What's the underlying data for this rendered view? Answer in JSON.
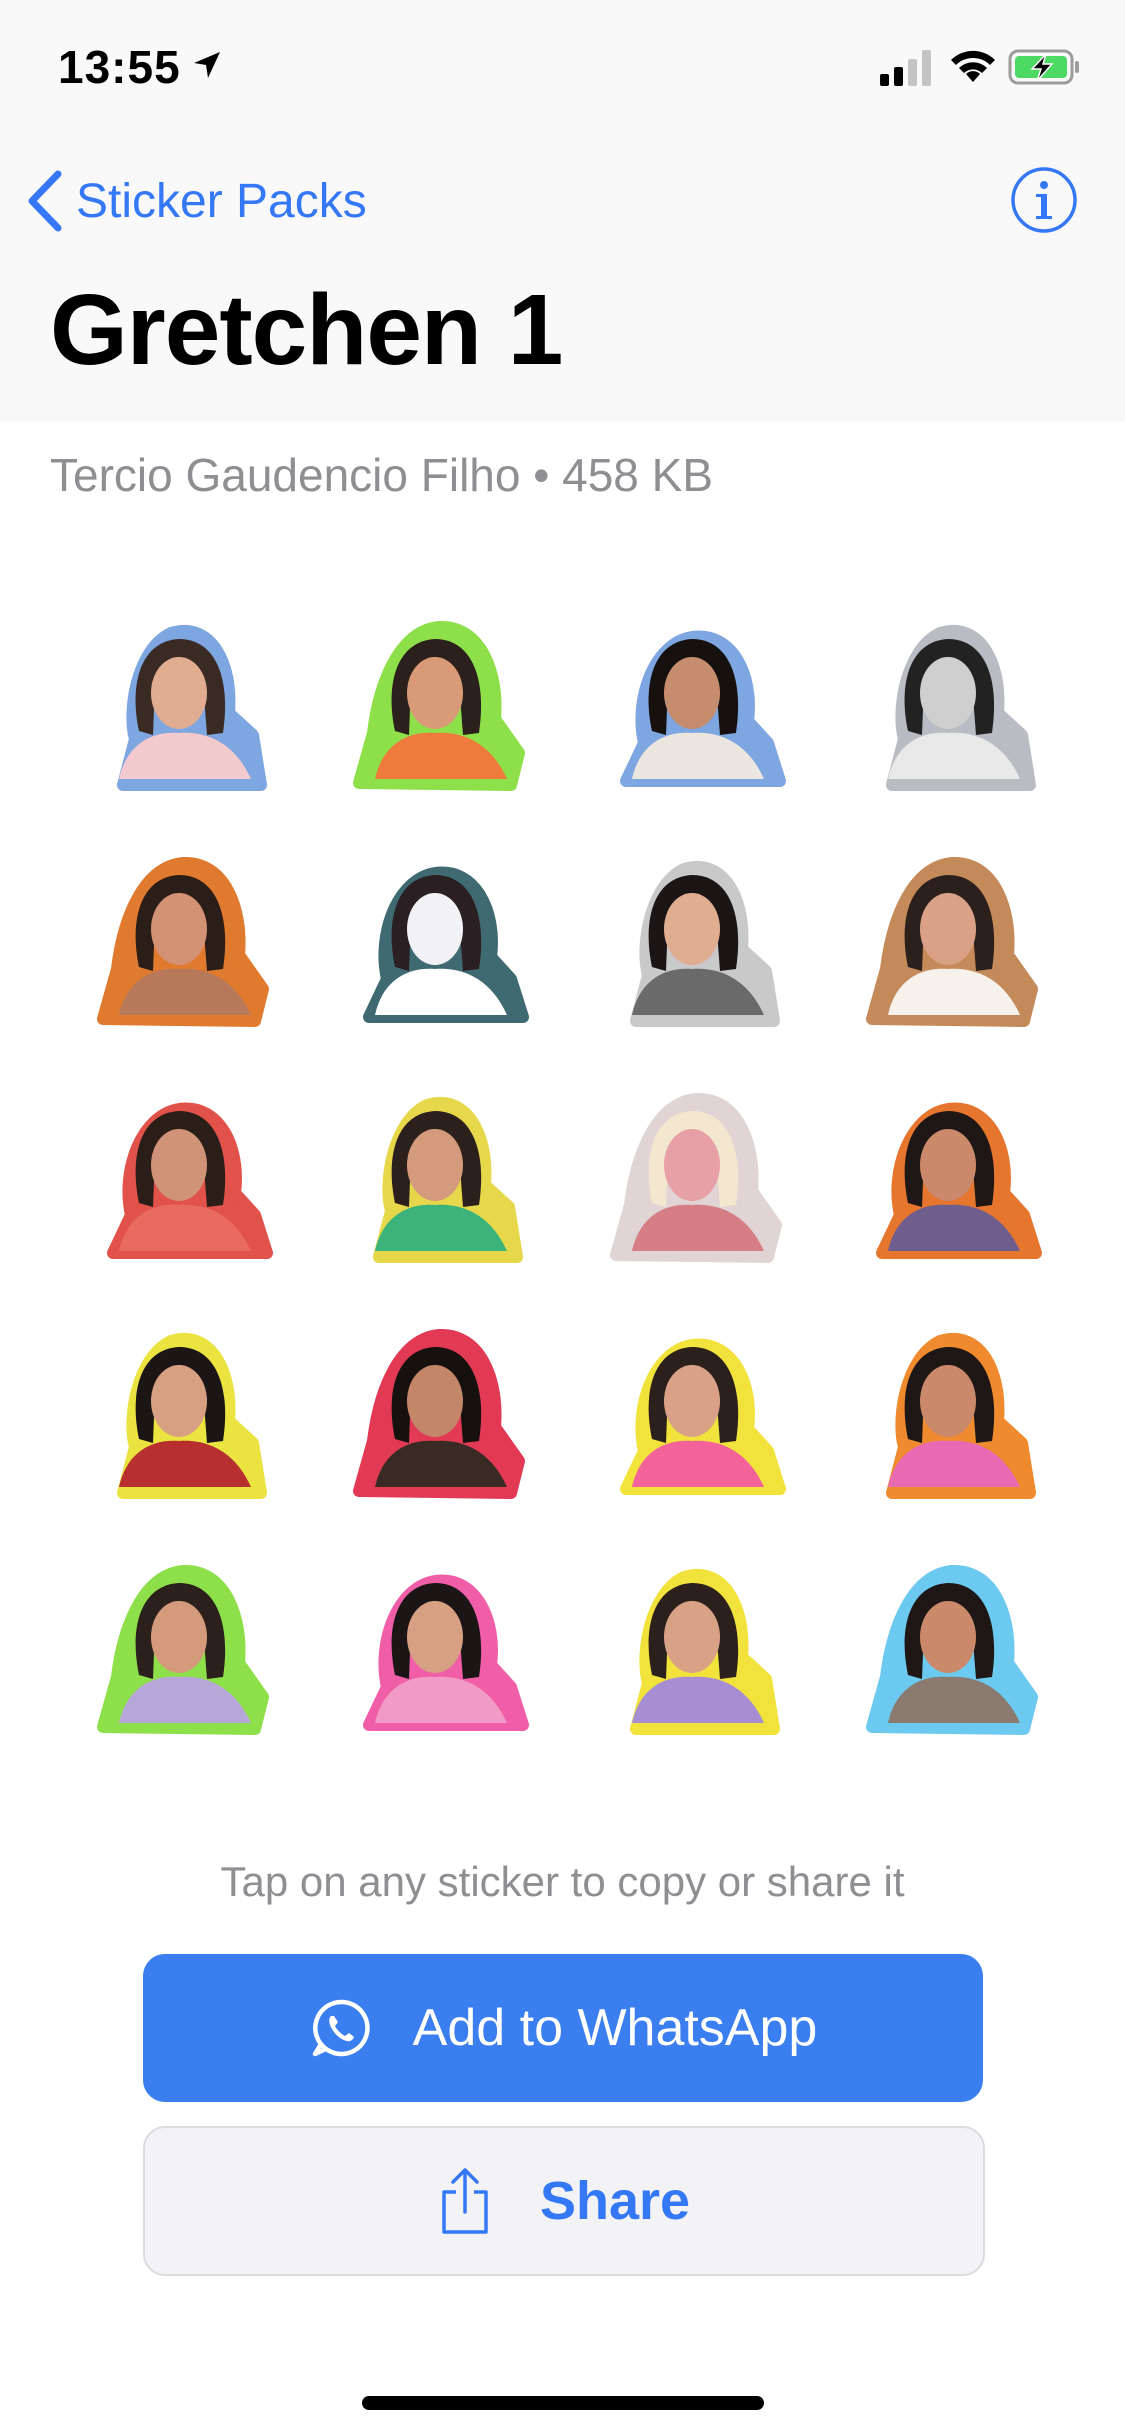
{
  "status_bar": {
    "time": "13:55",
    "icons": [
      "location-arrow-icon",
      "cellular-signal-icon",
      "wifi-icon",
      "battery-charging-icon"
    ],
    "battery_color": "#4cd964"
  },
  "nav": {
    "back_label": "Sticker Packs",
    "info_icon": "info-icon",
    "title": "Gretchen 1"
  },
  "pack": {
    "meta": "Tercio Gaudencio Filho • 458 KB"
  },
  "stickers": [
    {
      "outline": "#7ea6e0",
      "skin": "#e0ad90",
      "hair": "#3a2a24",
      "clothes": "#f2c9cc"
    },
    {
      "outline": "#8ee04a",
      "skin": "#d99a77",
      "hair": "#2b201c",
      "clothes": "#ee7a3c"
    },
    {
      "outline": "#7ea6e0",
      "skin": "#c58d6e",
      "hair": "#16110f",
      "clothes": "#ece6e0"
    },
    {
      "outline": "#b9bcc2",
      "skin": "#cfcfcf",
      "hair": "#222222",
      "clothes": "#e9e9e9"
    },
    {
      "outline": "#e07a2e",
      "skin": "#d49275",
      "hair": "#2b1d18",
      "clothes": "#b8785a"
    },
    {
      "outline": "#3f6a72",
      "skin": "#f2f2f5",
      "hair": "#2a1f22",
      "clothes": "#ffffff"
    },
    {
      "outline": "#c9c9c9",
      "skin": "#e0ad90",
      "hair": "#1b1515",
      "clothes": "#6a6a6a"
    },
    {
      "outline": "#c58a5a",
      "skin": "#d9a287",
      "hair": "#2b201c",
      "clothes": "#f6f1ea"
    },
    {
      "outline": "#e0524a",
      "skin": "#d09377",
      "hair": "#2b1d18",
      "clothes": "#e96a5e"
    },
    {
      "outline": "#e6d84a",
      "skin": "#d49a7c",
      "hair": "#2b201c",
      "clothes": "#3cb37a"
    },
    {
      "outline": "#e0d4d4",
      "skin": "#e7a0a6",
      "hair": "#f4e7cf",
      "clothes": "#d57e86"
    },
    {
      "outline": "#e6752e",
      "skin": "#c9896a",
      "hair": "#1e1716",
      "clothes": "#6f5e8d"
    },
    {
      "outline": "#eae340",
      "skin": "#d8a083",
      "hair": "#1c1515",
      "clothes": "#b82f2f"
    },
    {
      "outline": "#e23a55",
      "skin": "#c48668",
      "hair": "#16110f",
      "clothes": "#3a2a24"
    },
    {
      "outline": "#f1e23c",
      "skin": "#d9a287",
      "hair": "#2b201c",
      "clothes": "#f4629a"
    },
    {
      "outline": "#f08a2e",
      "skin": "#c9896a",
      "hair": "#1e1716",
      "clothes": "#e86ab2"
    },
    {
      "outline": "#8ee04a",
      "skin": "#d49a7c",
      "hair": "#2b201c",
      "clothes": "#b7a7d8"
    },
    {
      "outline": "#ef5ea7",
      "skin": "#d8a083",
      "hair": "#1c1515",
      "clothes": "#f29ac6"
    },
    {
      "outline": "#f1e23c",
      "skin": "#d9a287",
      "hair": "#2b201c",
      "clothes": "#a78ed3"
    },
    {
      "outline": "#6cc9ef",
      "skin": "#c9896a",
      "hair": "#1e1716",
      "clothes": "#8a7a70"
    }
  ],
  "hint": "Tap on any sticker to copy or share it",
  "buttons": {
    "add": "Add to WhatsApp",
    "add_icon": "whatsapp-icon",
    "add_color": "#3b7ef0",
    "share": "Share",
    "share_icon": "share-icon"
  },
  "colors": {
    "accent": "#3478f6",
    "secondary_text": "#8e8e93"
  }
}
